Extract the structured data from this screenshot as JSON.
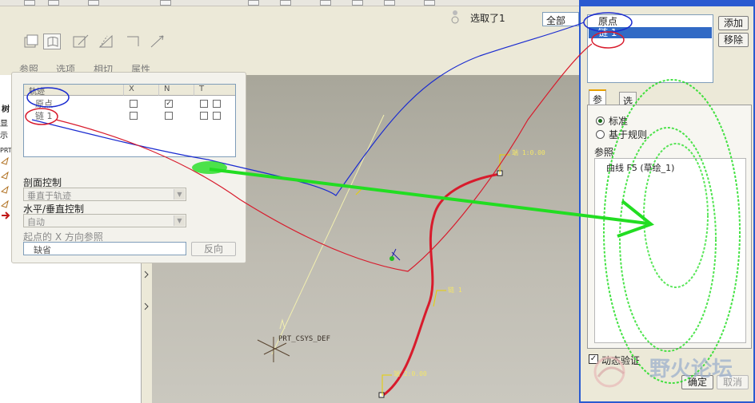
{
  "dashboard": {
    "tools": [
      {
        "label": "参照",
        "icon": "reference-icon"
      },
      {
        "label": "选项",
        "icon": "options-icon"
      },
      {
        "label": "相切",
        "icon": "tangent-icon"
      },
      {
        "label": "属性",
        "icon": "properties-icon"
      }
    ],
    "selection_status": "选取了1",
    "filter_value": "全部"
  },
  "left_strip": {
    "tab_labels": [
      "树",
      "显示",
      "PRT"
    ]
  },
  "reference_panel": {
    "table_headers": [
      "轨迹",
      "X",
      "N",
      "T"
    ],
    "rows": [
      {
        "name": "原点",
        "x": false,
        "n": true,
        "t": false
      },
      {
        "name": "链 1",
        "x": false,
        "n": false,
        "t": false
      }
    ],
    "section_label": "剖面控制",
    "section_value": "垂直于轨迹",
    "hv_label": "水平/垂直控制",
    "hv_value": "自动",
    "xref_label": "起点的 X 方向参照",
    "xref_value": "缺省",
    "flip_button": "反向"
  },
  "viewport": {
    "csys_label": "PRT_CSYS_DEF",
    "start_label": "端 1:0.00",
    "end_label": "端 2:0.00",
    "chain_label": "链 1"
  },
  "dialog": {
    "chain_items": [
      "原点",
      "链 1"
    ],
    "add_button": "添加",
    "remove_button": "移除",
    "tab_reference": "参照",
    "tab_options": "选项",
    "radio_standard": "标准",
    "radio_rule": "基于规则",
    "ref_label": "参照",
    "ref_item": "曲线 F5 (草绘_1)",
    "dynamic_check": "动态验证",
    "ok_button": "确定",
    "cancel_button": "取消"
  },
  "watermark": {
    "text": "野火论坛"
  },
  "colors": {
    "selection_blue": "#316ac5",
    "trajectory_red": "#d81b2c",
    "annotation_green": "#22dd22",
    "annotation_blue": "#1a2bd0",
    "annotation_red": "#d81b2c"
  }
}
